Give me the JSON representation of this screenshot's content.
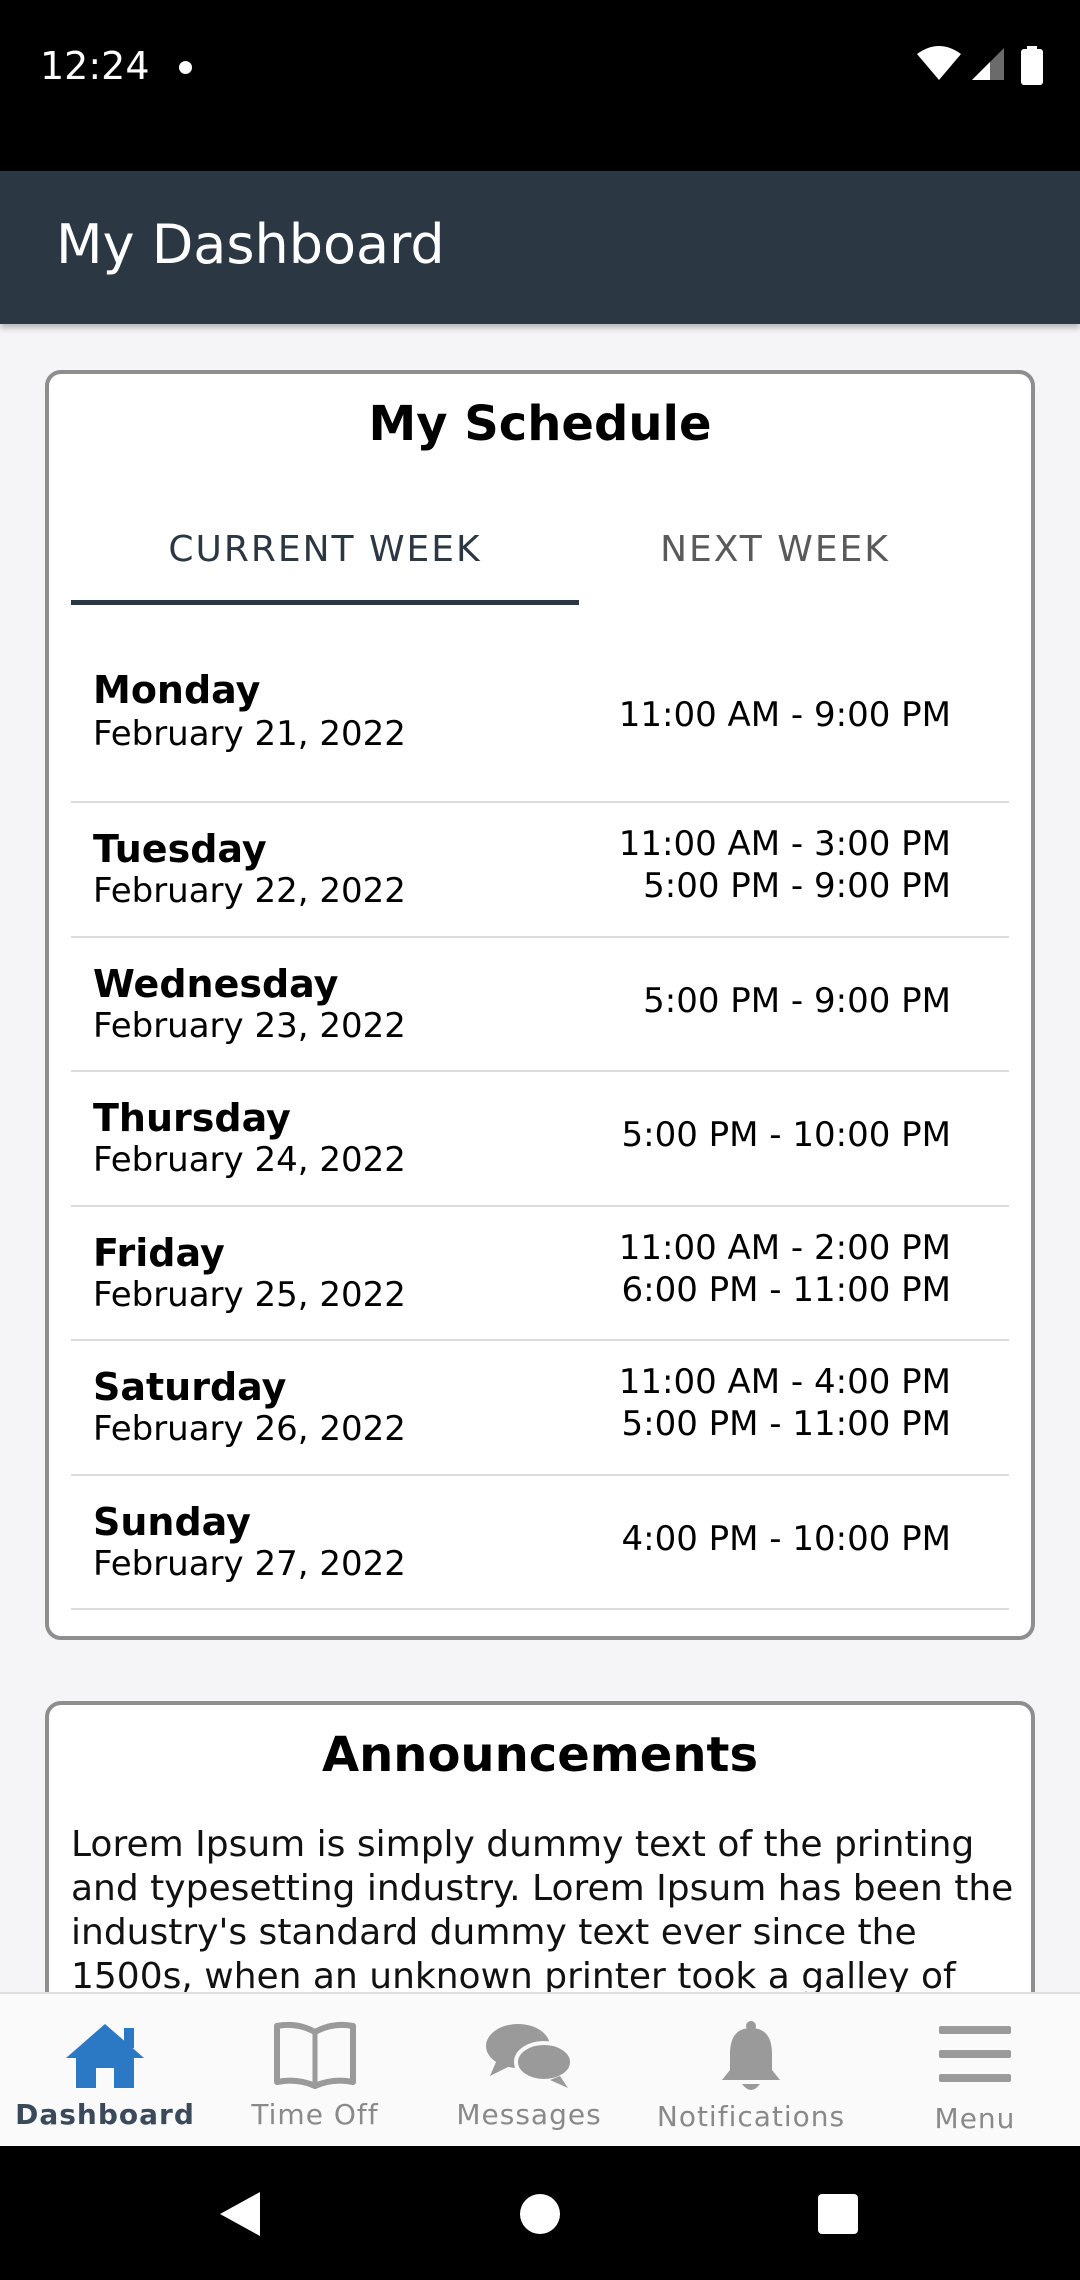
{
  "status_bar": {
    "time": "12:24"
  },
  "app_bar": {
    "title": "My Dashboard"
  },
  "schedule": {
    "title": "My Schedule",
    "tabs": [
      {
        "label": "CURRENT WEEK",
        "active": true
      },
      {
        "label": "NEXT WEEK",
        "active": false
      }
    ],
    "days": [
      {
        "day": "Monday",
        "date": "February 21, 2022",
        "shifts": [
          "11:00 AM - 9:00 PM"
        ]
      },
      {
        "day": "Tuesday",
        "date": "February 22, 2022",
        "shifts": [
          "11:00 AM - 3:00 PM",
          "5:00 PM - 9:00 PM"
        ]
      },
      {
        "day": "Wednesday",
        "date": "February 23, 2022",
        "shifts": [
          "5:00 PM - 9:00 PM"
        ]
      },
      {
        "day": "Thursday",
        "date": "February 24, 2022",
        "shifts": [
          "5:00 PM - 10:00 PM"
        ]
      },
      {
        "day": "Friday",
        "date": "February 25, 2022",
        "shifts": [
          "11:00 AM - 2:00 PM",
          "6:00 PM - 11:00 PM"
        ]
      },
      {
        "day": "Saturday",
        "date": "February 26, 2022",
        "shifts": [
          "11:00 AM - 4:00 PM",
          "5:00 PM - 11:00 PM"
        ]
      },
      {
        "day": "Sunday",
        "date": "February 27, 2022",
        "shifts": [
          "4:00 PM - 10:00 PM"
        ]
      }
    ]
  },
  "announcements": {
    "title": "Announcements",
    "text": "Lorem Ipsum is simply dummy text of the printing and typesetting industry. Lorem Ipsum has been the industry's standard dummy text ever since the 1500s, when an unknown printer took a galley of type and"
  },
  "bottom_nav": {
    "items": [
      {
        "label": "Dashboard",
        "icon": "home-icon",
        "active": true
      },
      {
        "label": "Time Off",
        "icon": "book-icon",
        "active": false
      },
      {
        "label": "Messages",
        "icon": "chat-bubbles-icon",
        "active": false
      },
      {
        "label": "Notifications",
        "icon": "bell-icon",
        "active": false
      },
      {
        "label": "Menu",
        "icon": "hamburger-menu-icon",
        "active": false
      }
    ]
  },
  "colors": {
    "app_bar": "#2b3844",
    "accent": "#2b78c4",
    "card_border": "#8e8e8e",
    "background": "#f5f5f7"
  }
}
